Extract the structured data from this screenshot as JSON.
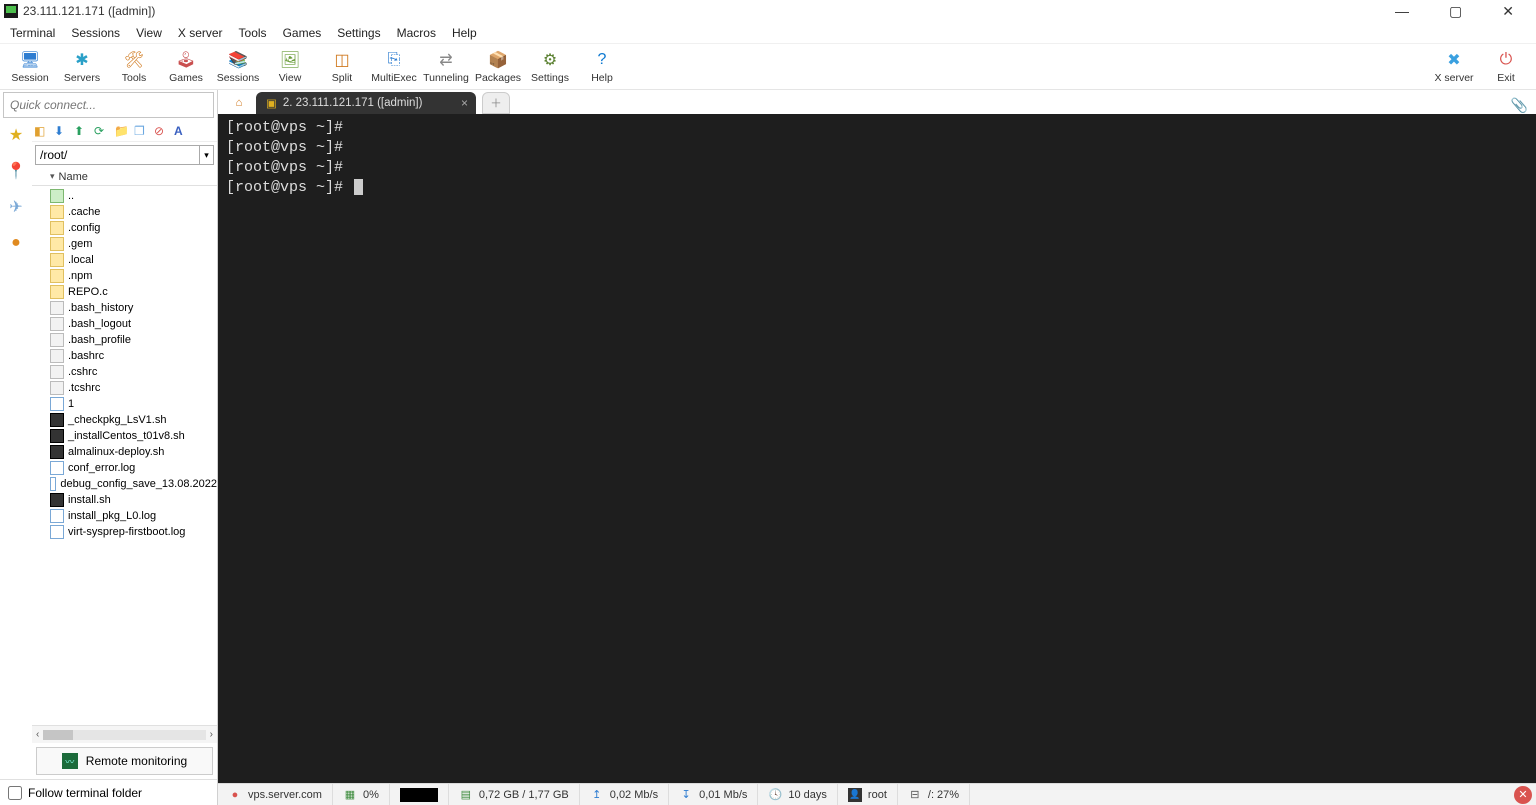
{
  "window": {
    "title": "23.111.121.171 ([admin])"
  },
  "menu": [
    "Terminal",
    "Sessions",
    "View",
    "X server",
    "Tools",
    "Games",
    "Settings",
    "Macros",
    "Help"
  ],
  "toolbar": [
    {
      "label": "Session",
      "icon": "🖥",
      "color": "#2e7dd1"
    },
    {
      "label": "Servers",
      "icon": "✱",
      "color": "#2aa0c8"
    },
    {
      "label": "Tools",
      "icon": "🛠",
      "color": "#d07a20"
    },
    {
      "label": "Games",
      "icon": "🕹",
      "color": "#c95050"
    },
    {
      "label": "Sessions",
      "icon": "📚",
      "color": "#448b48"
    },
    {
      "label": "View",
      "icon": "🖼",
      "color": "#6d9e3d"
    },
    {
      "label": "Split",
      "icon": "◫",
      "color": "#d07a20"
    },
    {
      "label": "MultiExec",
      "icon": "⎘",
      "color": "#2e7dd1"
    },
    {
      "label": "Tunneling",
      "icon": "⇄",
      "color": "#888"
    },
    {
      "label": "Packages",
      "icon": "📦",
      "color": "#4a88c7"
    },
    {
      "label": "Settings",
      "icon": "⚙",
      "color": "#5a8030"
    },
    {
      "label": "Help",
      "icon": "?",
      "color": "#0b78d1"
    }
  ],
  "toolbar_right": [
    {
      "label": "X server",
      "icon": "✖",
      "color": "#3aa0e0"
    },
    {
      "label": "Exit",
      "icon": "⏻",
      "color": "#d9534f"
    }
  ],
  "sidebar": {
    "quick_placeholder": "Quick connect...",
    "path": "/root/",
    "header": "Name",
    "files": [
      {
        "name": "..",
        "type": "up"
      },
      {
        "name": ".cache",
        "type": "folder"
      },
      {
        "name": ".config",
        "type": "folder"
      },
      {
        "name": ".gem",
        "type": "folder"
      },
      {
        "name": ".local",
        "type": "folder"
      },
      {
        "name": ".npm",
        "type": "folder"
      },
      {
        "name": "REPO.c",
        "type": "folder"
      },
      {
        "name": ".bash_history",
        "type": "file"
      },
      {
        "name": ".bash_logout",
        "type": "file"
      },
      {
        "name": ".bash_profile",
        "type": "file"
      },
      {
        "name": ".bashrc",
        "type": "file"
      },
      {
        "name": ".cshrc",
        "type": "file"
      },
      {
        "name": ".tcshrc",
        "type": "file"
      },
      {
        "name": "1",
        "type": "doc"
      },
      {
        "name": "_checkpkg_LsV1.sh",
        "type": "sh"
      },
      {
        "name": "_installCentos_t01v8.sh",
        "type": "sh"
      },
      {
        "name": "almalinux-deploy.sh",
        "type": "sh"
      },
      {
        "name": "conf_error.log",
        "type": "doc"
      },
      {
        "name": "debug_config_save_13.08.2022",
        "type": "doc"
      },
      {
        "name": "install.sh",
        "type": "sh"
      },
      {
        "name": "install_pkg_L0.log",
        "type": "doc"
      },
      {
        "name": "virt-sysprep-firstboot.log",
        "type": "doc"
      }
    ],
    "remote_monitoring": "Remote monitoring",
    "follow_label": "Follow terminal folder"
  },
  "tabs": {
    "active": "2. 23.111.121.171 ([admin])"
  },
  "terminal": {
    "prompt": "[root@vps ~]#",
    "line_count": 4
  },
  "status": {
    "host": "vps.server.com",
    "cpu": "0%",
    "mem": "0,72 GB / 1,77 GB",
    "up": "0,02 Mb/s",
    "down": "0,01 Mb/s",
    "uptime": "10 days",
    "user": "root",
    "disk": "/: 27%"
  }
}
